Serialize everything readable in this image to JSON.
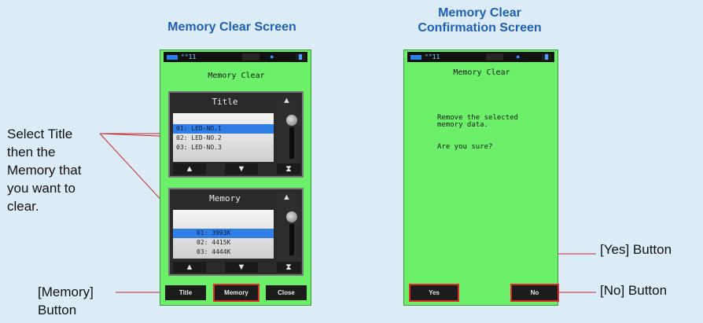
{
  "headings": {
    "left": "Memory Clear Screen",
    "right_line1": "Memory Clear",
    "right_line2": "Confirmation Screen"
  },
  "annotations": {
    "select_title": [
      "Select Title",
      "then the",
      "Memory that",
      "you want to",
      "clear."
    ],
    "memory_button": [
      "[Memory]",
      "Button"
    ],
    "yes_button": "[Yes] Button",
    "no_button": "[No] Button"
  },
  "status_bar": {
    "signal": "°°11"
  },
  "memory_clear_screen": {
    "title": "Memory Clear",
    "title_panel": {
      "header": "Title",
      "items": [
        "01: LED-NO.1",
        "02: LED-NO.2",
        "03: LED-NO.3"
      ],
      "selected_index": 0
    },
    "memory_panel": {
      "header": "Memory",
      "items": [
        "01:  3993K",
        "02:  4415K",
        "03:  4444K"
      ],
      "selected_index": 0
    },
    "nav": {
      "up": "▲",
      "down": "▼",
      "end": "⧗",
      "top": "⧗"
    },
    "buttons": {
      "title": "Title",
      "memory": "Memory",
      "close": "Close"
    }
  },
  "confirmation_screen": {
    "title": "Memory Clear",
    "message_line1": "Remove the selected",
    "message_line2": "memory data.",
    "question": "Are you sure?",
    "buttons": {
      "yes": "Yes",
      "no": "No"
    }
  },
  "colors": {
    "screen_bg": "#6cf06a",
    "heading": "#1f5fb4",
    "highlight": "#e02a2a",
    "selection": "#2f7fe6"
  }
}
